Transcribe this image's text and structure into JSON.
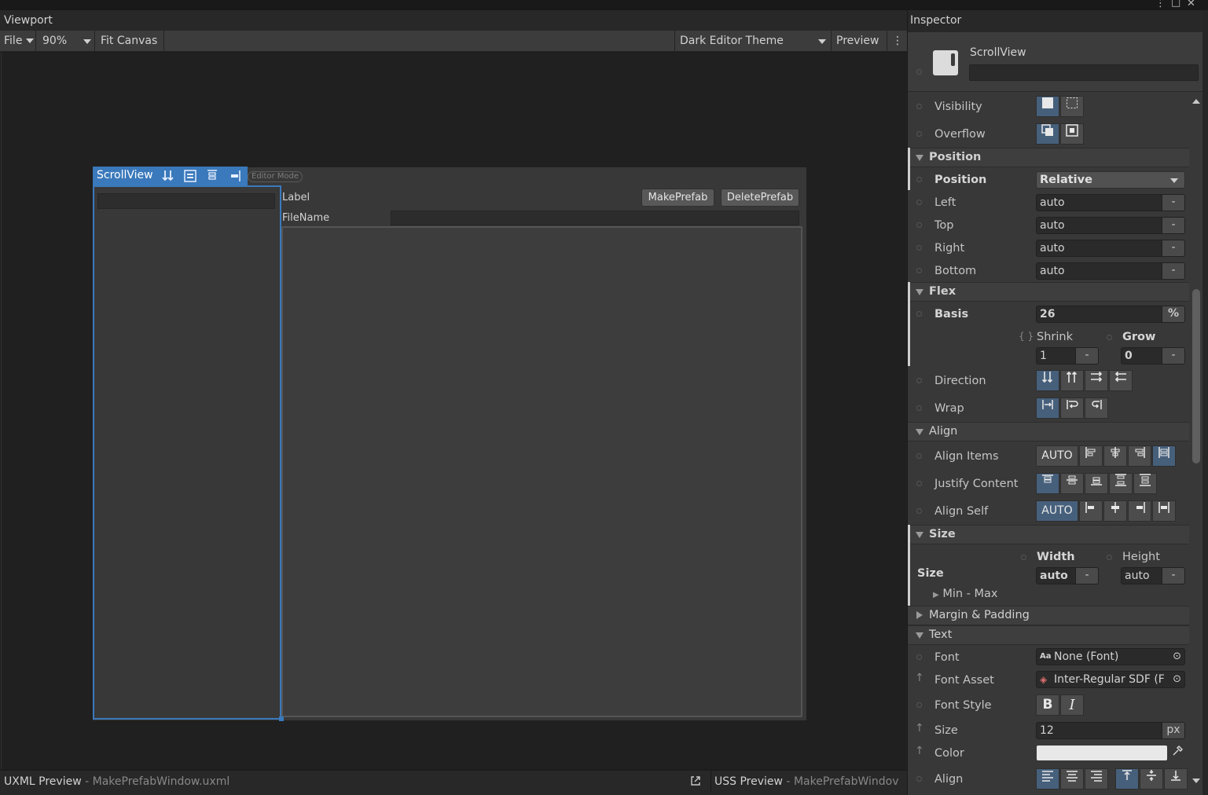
{
  "viewport": {
    "title": "Viewport",
    "toolbar": {
      "file": "File",
      "zoom": "90%",
      "fit_canvas": "Fit Canvas",
      "theme": "Dark Editor Theme",
      "preview": "Preview"
    },
    "document": {
      "scrollview_tag": "ScrollView",
      "editor_mode": "Editor Mode",
      "label": "Label",
      "make_prefab": "MakePrefab",
      "delete_prefab": "DeletePrefab",
      "file_name_label": "FileName"
    }
  },
  "bottom_bar": {
    "uxml_preview": "UXML Preview",
    "uxml_file": "MakePrefabWindow.uxml",
    "uss_preview": "USS Preview",
    "uss_file": "MakePrefabWindov"
  },
  "inspector": {
    "title": "Inspector",
    "element_name": "ScrollView",
    "visibility_label": "Visibility",
    "overflow_label": "Overflow",
    "position_section": "Position",
    "position_label": "Position",
    "position_value": "Relative",
    "left_label": "Left",
    "left_value": "auto",
    "top_label": "Top",
    "top_value": "auto",
    "right_label": "Right",
    "right_value": "auto",
    "bottom_label": "Bottom",
    "bottom_value": "auto",
    "flex_section": "Flex",
    "basis_label": "Basis",
    "basis_value": "26",
    "basis_unit": "%",
    "shrink_label": "Shrink",
    "shrink_value": "1",
    "grow_label": "Grow",
    "grow_value": "0",
    "direction_label": "Direction",
    "wrap_label": "Wrap",
    "align_section": "Align",
    "align_items_label": "Align Items",
    "align_items_auto": "AUTO",
    "justify_content_label": "Justify Content",
    "align_self_label": "Align Self",
    "align_self_auto": "AUTO",
    "size_section": "Size",
    "size_label": "Size",
    "width_label": "Width",
    "width_value": "auto",
    "height_label": "Height",
    "height_value": "auto",
    "min_max_label": "Min - Max",
    "margin_padding_section": "Margin & Padding",
    "text_section": "Text",
    "font_label": "Font",
    "font_value": "None (Font)",
    "font_asset_label": "Font Asset",
    "font_asset_value": "Inter-Regular SDF (F",
    "font_style_label": "Font Style",
    "font_style_bold": "B",
    "font_style_italic": "I",
    "text_size_label": "Size",
    "text_size_value": "12",
    "text_size_unit": "px",
    "color_label": "Color",
    "color_value": "#e8e8e8",
    "text_align_label": "Align",
    "unset_value": "-"
  },
  "colors": {
    "selection_blue": "#3a79bb",
    "toggle_on": "#46607c"
  }
}
